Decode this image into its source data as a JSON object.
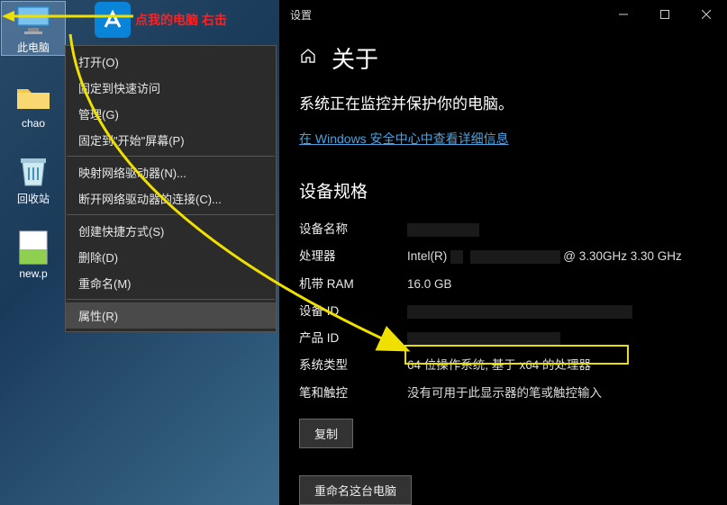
{
  "desktop": {
    "icons": {
      "this_pc": "此电脑",
      "chao": "chao",
      "recycle": "回收站",
      "newp": "new.p"
    }
  },
  "annotation": {
    "text": "点我的电脑 右击"
  },
  "context_menu": {
    "open": "打开(O)",
    "pin_quick": "固定到快速访问",
    "manage": "管理(G)",
    "pin_start": "固定到\"开始\"屏幕(P)",
    "map_drive": "映射网络驱动器(N)...",
    "disconnect_drive": "断开网络驱动器的连接(C)...",
    "create_shortcut": "创建快捷方式(S)",
    "delete": "删除(D)",
    "rename": "重命名(M)",
    "properties": "属性(R)"
  },
  "settings": {
    "window_title": "设置",
    "page_title": "关于",
    "monitor_text": "系统正在监控并保护你的电脑。",
    "security_link": "在 Windows 安全中心中查看详细信息",
    "section_specs": "设备规格",
    "labels": {
      "device_name": "设备名称",
      "processor": "处理器",
      "ram": "机带 RAM",
      "device_id": "设备 ID",
      "product_id": "产品 ID",
      "system_type": "系统类型",
      "pen_touch": "笔和触控"
    },
    "values": {
      "processor_pre": "Intel(R) ",
      "processor_post": " @ 3.30GHz   3.30 GHz",
      "ram": "16.0 GB",
      "system_type": "64 位操作系统, 基于 x64 的处理器",
      "pen_touch": "没有可用于此显示器的笔或触控输入"
    },
    "copy_btn": "复制",
    "rename_btn": "重命名这台电脑"
  }
}
